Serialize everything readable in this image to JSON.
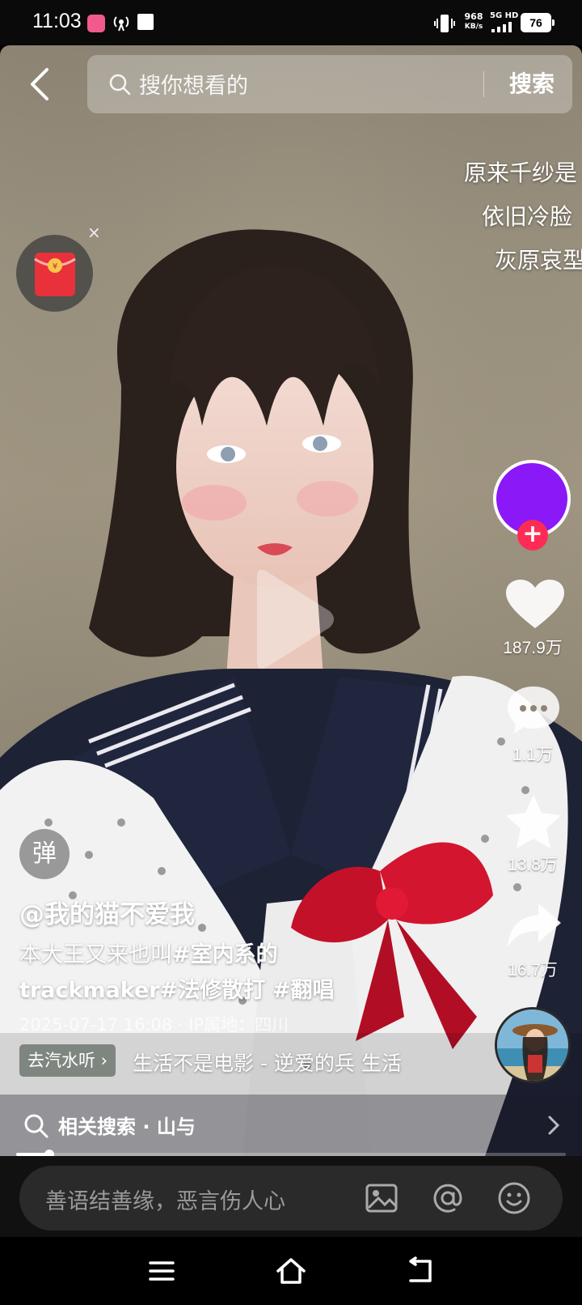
{
  "status_bar": {
    "time": "11:03",
    "net_speed_value": "968",
    "net_speed_unit": "KB/s",
    "network_label": "5G HD",
    "battery": "76"
  },
  "top": {
    "search_placeholder": "搜你想看的",
    "search_button": "搜索"
  },
  "lyrics": [
    "原来千纱是",
    "依旧冷脸",
    "灰原哀型"
  ],
  "rail": {
    "likes": "187.9万",
    "comments": "1.1万",
    "favorites": "13.8万",
    "shares": "16.7万"
  },
  "video_info": {
    "danmu_label": "弹",
    "author": "@我的猫不爱我",
    "desc_line1_text": "本大王又来也叫",
    "desc_tag1": "#室内系的",
    "desc_line2_text": "trackmaker",
    "desc_tag2": "#法修散打",
    "desc_tag3": "#翻唱",
    "date_location": "2025-07-17 16:08 · IP属地：四川",
    "music_tag": "去汽水听",
    "music_title": "生活不是电影 - 逆爱的兵   生活"
  },
  "related": {
    "label": "相关搜索 · 山与"
  },
  "progress": {
    "fraction": 0.06
  },
  "comment_bar": {
    "placeholder": "善语结善缘，恶言伤人心"
  },
  "colors": {
    "avatar": "#8b18f7",
    "follow": "#fe2c55",
    "red_packet": "#e8313b"
  }
}
